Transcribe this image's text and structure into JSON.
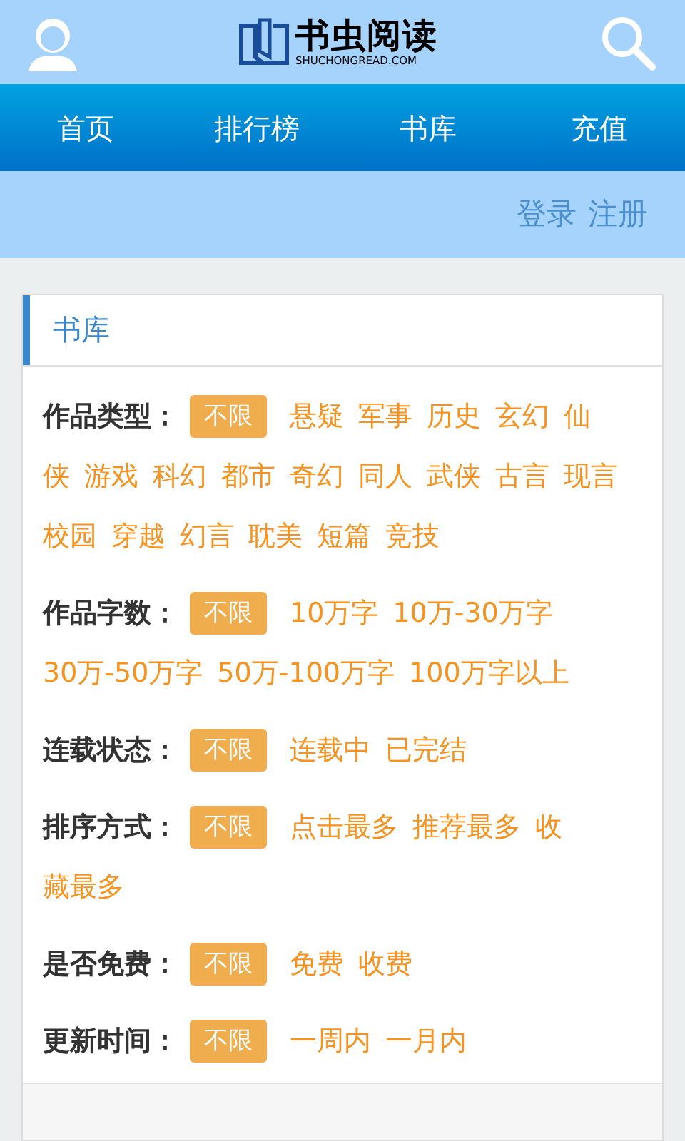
{
  "header": {
    "logo_title": "书虫阅读",
    "logo_subtitle": "SHUCHONGREAD.COM"
  },
  "nav": [
    {
      "label": "首页"
    },
    {
      "label": "排行榜"
    },
    {
      "label": "书库"
    },
    {
      "label": "充值"
    }
  ],
  "account_links": [
    {
      "label": "登录"
    },
    {
      "label": "注册"
    }
  ],
  "panel": {
    "title": "书库",
    "filters": [
      {
        "label": "作品类型：",
        "options": [
          {
            "label": "不限",
            "selected": true
          },
          {
            "label": "悬疑",
            "selected": false
          },
          {
            "label": "军事",
            "selected": false
          },
          {
            "label": "历史",
            "selected": false
          },
          {
            "label": "玄幻",
            "selected": false
          },
          {
            "label": "仙",
            "selected": false
          },
          {
            "label": "侠",
            "selected": false
          },
          {
            "label": "游戏",
            "selected": false
          },
          {
            "label": "科幻",
            "selected": false
          },
          {
            "label": "都市",
            "selected": false
          },
          {
            "label": "奇幻",
            "selected": false
          },
          {
            "label": "同人",
            "selected": false
          },
          {
            "label": "武侠",
            "selected": false
          },
          {
            "label": "古言",
            "selected": false
          },
          {
            "label": "现言",
            "selected": false
          },
          {
            "label": "校园",
            "selected": false
          },
          {
            "label": "穿越",
            "selected": false
          },
          {
            "label": "幻言",
            "selected": false
          },
          {
            "label": "耽美",
            "selected": false
          },
          {
            "label": "短篇",
            "selected": false
          },
          {
            "label": "竞技",
            "selected": false
          }
        ]
      },
      {
        "label": "作品字数：",
        "options": [
          {
            "label": "不限",
            "selected": true
          },
          {
            "label": "10万字",
            "selected": false
          },
          {
            "label": "10万-30万字",
            "selected": false
          },
          {
            "label": "30万-50万字",
            "selected": false
          },
          {
            "label": "50万-100万字",
            "selected": false
          },
          {
            "label": "100万字以上",
            "selected": false
          }
        ]
      },
      {
        "label": "连载状态：",
        "options": [
          {
            "label": "不限",
            "selected": true
          },
          {
            "label": "连载中",
            "selected": false
          },
          {
            "label": "已完结",
            "selected": false
          }
        ]
      },
      {
        "label": "排序方式：",
        "options": [
          {
            "label": "不限",
            "selected": true
          },
          {
            "label": "点击最多",
            "selected": false
          },
          {
            "label": "推荐最多",
            "selected": false
          },
          {
            "label": "收",
            "selected": false
          },
          {
            "label": "藏最多",
            "selected": false
          }
        ]
      },
      {
        "label": "是否免费：",
        "options": [
          {
            "label": "不限",
            "selected": true
          },
          {
            "label": "免费",
            "selected": false
          },
          {
            "label": "收费",
            "selected": false
          }
        ]
      },
      {
        "label": "更新时间：",
        "options": [
          {
            "label": "不限",
            "selected": true
          },
          {
            "label": "一周内",
            "selected": false
          },
          {
            "label": "一月内",
            "selected": false
          }
        ]
      }
    ]
  }
}
